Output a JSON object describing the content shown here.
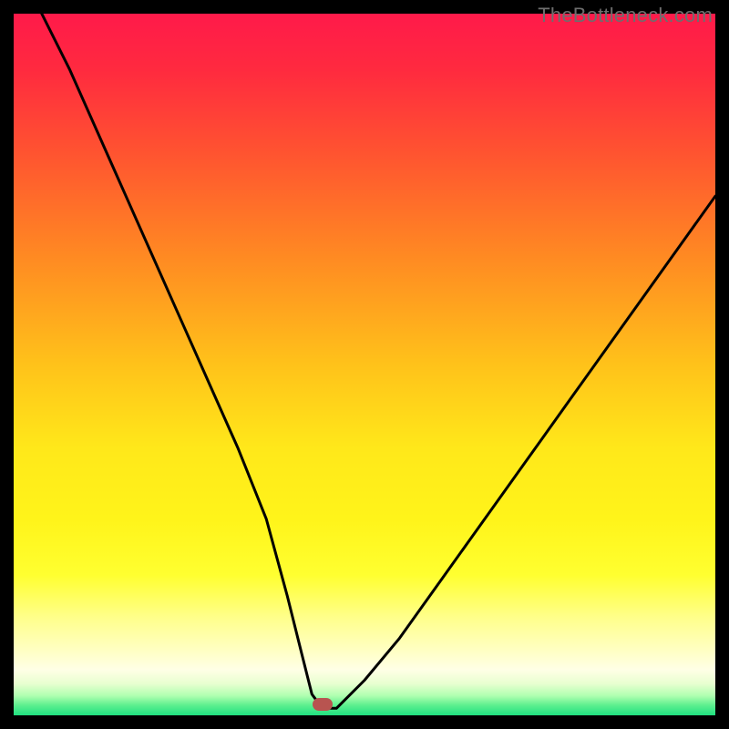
{
  "watermark": "TheBottleneck.com",
  "colors": {
    "frame": "#000000",
    "marker": "#b85450",
    "curve": "#000000",
    "gradient_stops": [
      {
        "offset": 0,
        "color": "#ff1a4a"
      },
      {
        "offset": 0.08,
        "color": "#ff2a3f"
      },
      {
        "offset": 0.2,
        "color": "#ff5430"
      },
      {
        "offset": 0.35,
        "color": "#ff8b22"
      },
      {
        "offset": 0.5,
        "color": "#ffc21a"
      },
      {
        "offset": 0.62,
        "color": "#ffe81a"
      },
      {
        "offset": 0.72,
        "color": "#fff41a"
      },
      {
        "offset": 0.8,
        "color": "#ffff30"
      },
      {
        "offset": 0.86,
        "color": "#ffff8a"
      },
      {
        "offset": 0.905,
        "color": "#ffffc0"
      },
      {
        "offset": 0.935,
        "color": "#ffffe6"
      },
      {
        "offset": 0.955,
        "color": "#e8ffd0"
      },
      {
        "offset": 0.972,
        "color": "#b0ffb0"
      },
      {
        "offset": 0.985,
        "color": "#60f090"
      },
      {
        "offset": 1.0,
        "color": "#20e080"
      }
    ]
  },
  "chart_data": {
    "type": "line",
    "title": "",
    "xlabel": "",
    "ylabel": "",
    "xlim": [
      0,
      100
    ],
    "ylim": [
      0,
      100
    ],
    "grid": false,
    "series": [
      {
        "name": "bottleneck-curve",
        "x": [
          4,
          8,
          12,
          16,
          20,
          24,
          28,
          32,
          36,
          39,
          41,
          42.5,
          44,
          46,
          50,
          55,
          60,
          65,
          70,
          75,
          80,
          85,
          90,
          95,
          100
        ],
        "values": [
          100,
          92,
          83,
          74,
          65,
          56,
          47,
          38,
          28,
          17,
          9,
          3,
          1,
          1,
          5,
          11,
          18,
          25,
          32,
          39,
          46,
          53,
          60,
          67,
          74
        ]
      }
    ],
    "marker": {
      "x": 44,
      "y": 1.5
    }
  }
}
